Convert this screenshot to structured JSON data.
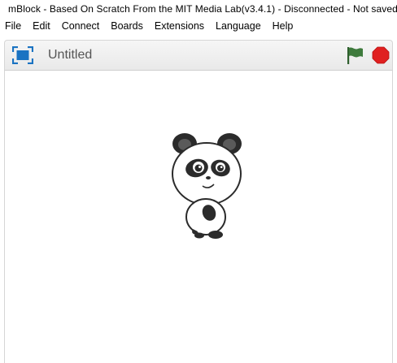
{
  "window": {
    "title": "mBlock - Based On Scratch From the MIT Media Lab(v3.4.1) - Disconnected - Not saved",
    "app_icon": "mblock-robot-icon"
  },
  "menu": {
    "items": [
      {
        "label": "File"
      },
      {
        "label": "Edit"
      },
      {
        "label": "Connect"
      },
      {
        "label": "Boards"
      },
      {
        "label": "Extensions"
      },
      {
        "label": "Language"
      },
      {
        "label": "Help"
      }
    ]
  },
  "stage_header": {
    "project_title": "Untitled",
    "fullscreen_icon": "fullscreen-icon",
    "flag_icon": "green-flag-icon",
    "stop_icon": "stop-icon"
  },
  "stage": {
    "sprite_name_icon": "panda-sprite"
  },
  "colors": {
    "fullscreen_blue": "#1a73c2",
    "flag_green": "#3e7a3c",
    "stop_red": "#e02020",
    "header_bg": "#efefef",
    "title_gray": "#555555"
  }
}
